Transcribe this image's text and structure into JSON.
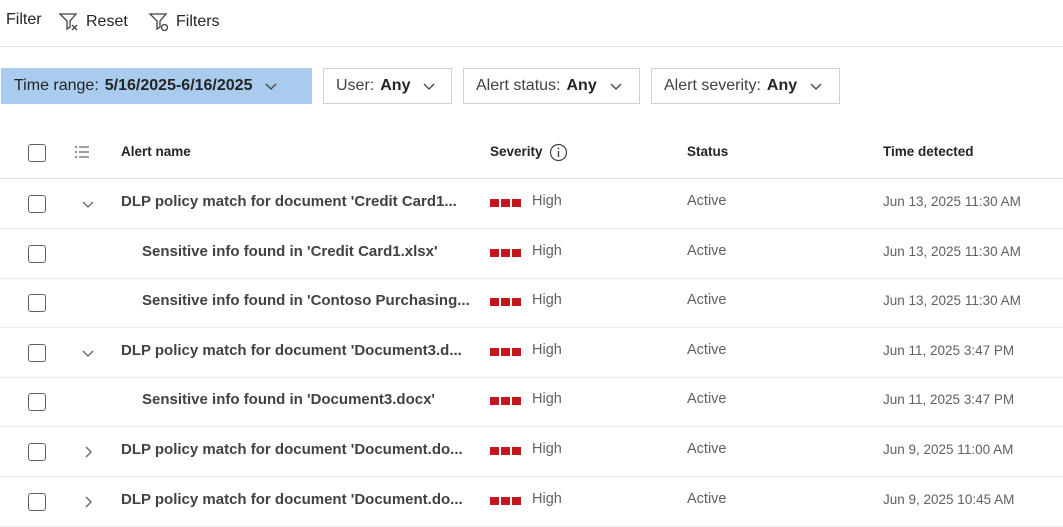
{
  "toolbar": {
    "filter_label": "Filter",
    "reset_label": "Reset",
    "filters_label": "Filters"
  },
  "pills": [
    {
      "label": "Time range:",
      "value": "5/16/2025-6/16/2025"
    },
    {
      "label": "User:",
      "value": "Any"
    },
    {
      "label": "Alert status:",
      "value": "Any"
    },
    {
      "label": "Alert severity:",
      "value": "Any"
    }
  ],
  "columns": {
    "alert_name": "Alert name",
    "severity": "Severity",
    "status": "Status",
    "time_detected": "Time detected"
  },
  "rows": [
    {
      "name": "DLP policy match for document 'Credit Card1...",
      "severity": "High",
      "status": "Active",
      "time": "Jun 13, 2025 11:30 AM",
      "expander": "expanded"
    },
    {
      "name": "Sensitive info found in 'Credit Card1.xlsx'",
      "severity": "High",
      "status": "Active",
      "time": "Jun 13, 2025 11:30 AM",
      "expander": "child"
    },
    {
      "name": "Sensitive info found in 'Contoso Purchasing...",
      "severity": "High",
      "status": "Active",
      "time": "Jun 13, 2025 11:30 AM",
      "expander": "child"
    },
    {
      "name": "DLP policy match for document 'Document3.d...",
      "severity": "High",
      "status": "Active",
      "time": "Jun 11, 2025 3:47 PM",
      "expander": "expanded"
    },
    {
      "name": "Sensitive info found in 'Document3.docx'",
      "severity": "High",
      "status": "Active",
      "time": "Jun 11, 2025 3:47 PM",
      "expander": "child"
    },
    {
      "name": "DLP policy match for document 'Document.do...",
      "severity": "High",
      "status": "Active",
      "time": "Jun 9, 2025 11:00 AM",
      "expander": "collapsed"
    },
    {
      "name": "DLP policy match for document 'Document.do...",
      "severity": "High",
      "status": "Active",
      "time": "Jun 9, 2025 10:45 AM",
      "expander": "collapsed"
    }
  ],
  "colors": {
    "severity_high": "#c4161c",
    "active_pill": "#a9cbed"
  }
}
